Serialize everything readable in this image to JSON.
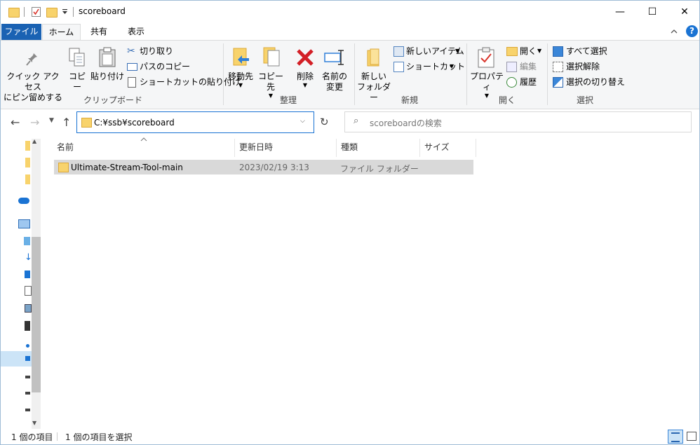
{
  "window": {
    "title": "scoreboard",
    "controls": {
      "minimize": "—",
      "maximize": "☐",
      "close": "✕"
    }
  },
  "tabs": [
    {
      "label": "ファイル"
    },
    {
      "label": "ホーム"
    },
    {
      "label": "共有"
    },
    {
      "label": "表示"
    }
  ],
  "ribbon": {
    "clipboard": {
      "group_label": "クリップボード",
      "pin_line1": "クイック アクセス",
      "pin_line2": "にピン留めする",
      "copy": "コピー",
      "paste": "貼り付け",
      "cut": "切り取り",
      "copy_path": "パスのコピー",
      "paste_shortcut": "ショートカットの貼り付け"
    },
    "organize": {
      "group_label": "整理",
      "move_to": "移動先",
      "copy_to": "コピー先",
      "delete": "削除",
      "rename_line1": "名前の",
      "rename_line2": "変更"
    },
    "new": {
      "group_label": "新規",
      "new_folder_line1": "新しい",
      "new_folder_line2": "フォルダー",
      "new_item": "新しいアイテム",
      "easy_access": "ショートカット"
    },
    "open": {
      "group_label": "開く",
      "properties": "プロパティ",
      "open": "開く",
      "edit": "編集",
      "history": "履歴"
    },
    "select": {
      "group_label": "選択",
      "select_all": "すべて選択",
      "select_none": "選択解除",
      "invert": "選択の切り替え"
    }
  },
  "address": {
    "path": "C:¥ssb¥scoreboard",
    "search_placeholder": "scoreboardの検索"
  },
  "columns": [
    {
      "label": "名前"
    },
    {
      "label": "更新日時"
    },
    {
      "label": "種類"
    },
    {
      "label": "サイズ"
    }
  ],
  "files": [
    {
      "name": "Ultimate-Stream-Tool-main",
      "modified": "2023/02/19 3:13",
      "type": "ファイル フォルダー",
      "size": ""
    }
  ],
  "status": {
    "count": "1 個の項目",
    "selected": "1 個の項目を選択"
  },
  "colors": {
    "accent": "#1a62b3",
    "folder": "#f8d36c",
    "selection": "#d9d9d9"
  }
}
